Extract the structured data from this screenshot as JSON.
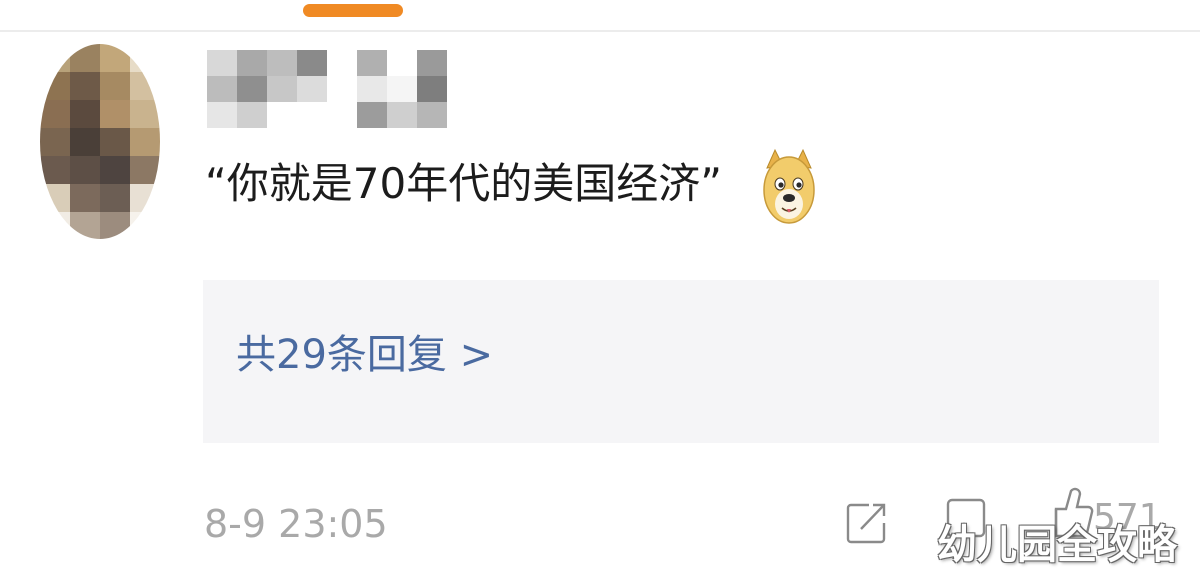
{
  "comment": {
    "text": "“你就是70年代的美国经济”",
    "emoji": "doge-emoji"
  },
  "replies": {
    "link_text": "共29条回复 >"
  },
  "footer": {
    "timestamp": "8-9 23:05",
    "like_count": "571",
    "icons": [
      "share-icon",
      "comment-icon",
      "like-icon"
    ]
  },
  "watermark": {
    "text": "幼儿园全攻略"
  },
  "colors": {
    "accent_orange": "#f08a24",
    "link_blue": "#4a6aa0",
    "reply_bg": "#f5f5f7",
    "meta_gray": "#a9a9a9"
  }
}
